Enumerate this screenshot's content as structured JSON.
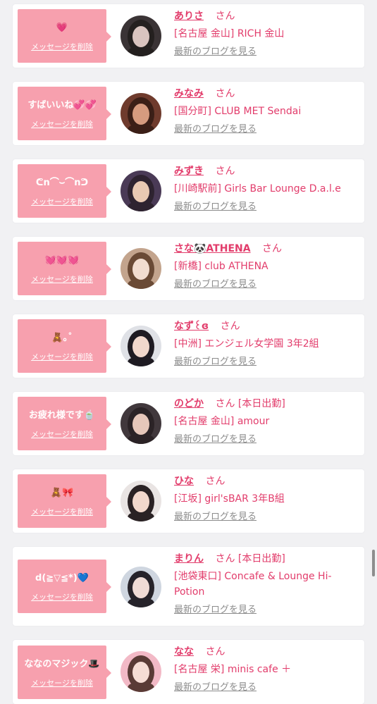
{
  "delete_label": "メッセージを削除",
  "blog_label": "最新のブログを見る",
  "san_label": "さん",
  "accent_color": "#e23c6b",
  "bubble_color": "#f7a0ae",
  "cards": [
    {
      "message": "💗",
      "name": "ありさ",
      "status": "",
      "shop": "[名古屋 金山] RICH 金山",
      "avatar": {
        "bg": "#3a3335",
        "face": "#d9c4bf",
        "hair": "#24201f"
      }
    },
    {
      "message": "すばいいね💞💞",
      "name": "みなみ",
      "status": "",
      "shop": "[国分町] CLUB MET Sendai",
      "avatar": {
        "bg": "#6f3b2d",
        "face": "#d69b7f",
        "hair": "#3b1f17"
      }
    },
    {
      "message": "ᕦn⌒⌣⌒nᕤ",
      "name": "みずき",
      "status": "",
      "shop": "[川崎駅前] Girls Bar Lounge D.a.l.e",
      "avatar": {
        "bg": "#4a3a56",
        "face": "#e9c9b3",
        "hair": "#2e2330"
      }
    },
    {
      "message": "💓💓💓",
      "name": "さな🐼ATHENA",
      "status": "",
      "shop": "[新橋] club ATHENA",
      "avatar": {
        "bg": "#c3a48d",
        "face": "#f2ddd0",
        "hair": "#6a4a35"
      }
    },
    {
      "message": "🧸｡˚",
      "name": "なず꒰ɞ",
      "status": "",
      "shop": "[中洲] エンジェル女学園 3年2組",
      "avatar": {
        "bg": "#dfe1e6",
        "face": "#f1d8cc",
        "hair": "#1e1b22"
      }
    },
    {
      "message": "お疲れ様です🍵",
      "name": "のどか",
      "status": "[本日出勤]",
      "shop": "[名古屋 金山] amour",
      "avatar": {
        "bg": "#41383c",
        "face": "#e6c7ba",
        "hair": "#2b2326"
      }
    },
    {
      "message": "🧸🎀",
      "name": "ひな",
      "status": "",
      "shop": "[江坂] girl'sBAR 3年B組",
      "avatar": {
        "bg": "#e9e4e3",
        "face": "#f2d8cc",
        "hair": "#2a2224"
      }
    },
    {
      "message": "d(≧▽≦*)💙",
      "name": "まりん",
      "status": "[本日出勤]",
      "shop": "[池袋東口] Concafe & Lounge Hi-Potion",
      "avatar": {
        "bg": "#cfd6e0",
        "face": "#f0dcd6",
        "hair": "#26232a"
      }
    },
    {
      "message": "ななのマジック🎩",
      "name": "なな",
      "status": "",
      "shop": "[名古屋 栄] minis cafe ＋",
      "avatar": {
        "bg": "#f2b9c6",
        "face": "#f6ddd5",
        "hair": "#5a3b36"
      }
    }
  ]
}
